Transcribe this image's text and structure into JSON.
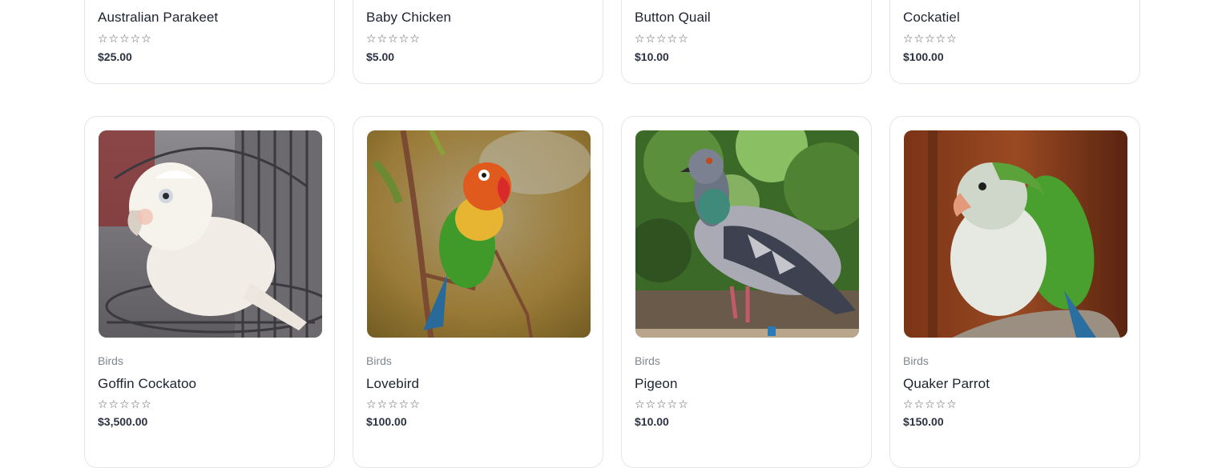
{
  "products_top": [
    {
      "title": "Australian Parakeet",
      "rating": "☆☆☆☆☆",
      "price": "$25.00"
    },
    {
      "title": "Baby Chicken",
      "rating": "☆☆☆☆☆",
      "price": "$5.00"
    },
    {
      "title": "Button Quail",
      "rating": "☆☆☆☆☆",
      "price": "$10.00"
    },
    {
      "title": "Cockatiel",
      "rating": "☆☆☆☆☆",
      "price": "$100.00"
    }
  ],
  "products_bottom": [
    {
      "category": "Birds",
      "title": "Goffin Cockatoo",
      "rating": "☆☆☆☆☆",
      "price": "$3,500.00",
      "image": "goffin-cockatoo-photo"
    },
    {
      "category": "Birds",
      "title": "Lovebird",
      "rating": "☆☆☆☆☆",
      "price": "$100.00",
      "image": "lovebird-photo"
    },
    {
      "category": "Birds",
      "title": "Pigeon",
      "rating": "☆☆☆☆☆",
      "price": "$10.00",
      "image": "pigeon-photo"
    },
    {
      "category": "Birds",
      "title": "Quaker Parrot",
      "rating": "☆☆☆☆☆",
      "price": "$150.00",
      "image": "quaker-parrot-photo"
    }
  ],
  "colors": {
    "card_border": "#e3e5ea",
    "title": "#1c2230",
    "category": "#80868f",
    "price": "#2b3240"
  }
}
